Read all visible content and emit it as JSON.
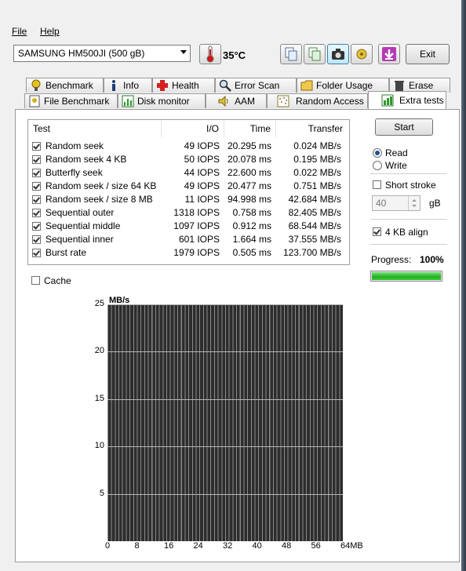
{
  "menu": {
    "file": "File",
    "help": "Help"
  },
  "toolbar": {
    "drive": "SAMSUNG HM500JI (500 gB)",
    "temperature": "35°C",
    "exit_label": "Exit"
  },
  "tabs_row1": [
    {
      "label": "Benchmark",
      "icon": "benchmark-icon"
    },
    {
      "label": "Info",
      "icon": "info-icon"
    },
    {
      "label": "Health",
      "icon": "health-cross-icon"
    },
    {
      "label": "Error Scan",
      "icon": "magnifier-icon"
    },
    {
      "label": "Folder Usage",
      "icon": "folder-icon"
    },
    {
      "label": "Erase",
      "icon": "trash-icon"
    }
  ],
  "tabs_row2": [
    {
      "label": "File Benchmark",
      "icon": "file-benchmark-icon"
    },
    {
      "label": "Disk monitor",
      "icon": "disk-monitor-icon"
    },
    {
      "label": "AAM",
      "icon": "speaker-icon"
    },
    {
      "label": "Random Access",
      "icon": "random-access-icon"
    },
    {
      "label": "Extra tests",
      "icon": "extra-tests-icon"
    }
  ],
  "table": {
    "headers": {
      "test": "Test",
      "io": "I/O",
      "time": "Time",
      "transfer": "Transfer"
    },
    "rows": [
      {
        "test": "Random seek",
        "io": "49 IOPS",
        "time": "20.295 ms",
        "transfer": "0.024 MB/s",
        "checked": true
      },
      {
        "test": "Random seek 4 KB",
        "io": "50 IOPS",
        "time": "20.078 ms",
        "transfer": "0.195 MB/s",
        "checked": true
      },
      {
        "test": "Butterfly seek",
        "io": "44 IOPS",
        "time": "22.600 ms",
        "transfer": "0.022 MB/s",
        "checked": true
      },
      {
        "test": "Random seek / size 64 KB",
        "io": "49 IOPS",
        "time": "20.477 ms",
        "transfer": "0.751 MB/s",
        "checked": true
      },
      {
        "test": "Random seek / size 8 MB",
        "io": "11 IOPS",
        "time": "94.998 ms",
        "transfer": "42.684 MB/s",
        "checked": true
      },
      {
        "test": "Sequential outer",
        "io": "1318 IOPS",
        "time": "0.758 ms",
        "transfer": "82.405 MB/s",
        "checked": true
      },
      {
        "test": "Sequential middle",
        "io": "1097 IOPS",
        "time": "0.912 ms",
        "transfer": "68.544 MB/s",
        "checked": true
      },
      {
        "test": "Sequential inner",
        "io": "601 IOPS",
        "time": "1.664 ms",
        "transfer": "37.555 MB/s",
        "checked": true
      },
      {
        "test": "Burst rate",
        "io": "1979 IOPS",
        "time": "0.505 ms",
        "transfer": "123.700 MB/s",
        "checked": true
      }
    ]
  },
  "options": {
    "start_label": "Start",
    "read_label": "Read",
    "write_label": "Write",
    "mode_selected": "Read",
    "short_stroke_label": "Short stroke",
    "short_stroke_checked": false,
    "short_stroke_value": "40",
    "short_stroke_unit": "gB",
    "align_label": "4 KB align",
    "align_checked": true,
    "progress_label": "Progress:",
    "progress_text": "100%",
    "progress_value": 1.0,
    "cache_label": "Cache",
    "cache_checked": false
  },
  "chart_data": {
    "type": "bar",
    "unit_label": "MB/s",
    "x_tick_labels": [
      "0",
      "8",
      "16",
      "24",
      "32",
      "40",
      "48",
      "56",
      "64MB"
    ],
    "y_tick_labels": [
      "5",
      "10",
      "15",
      "20",
      "25"
    ],
    "xlim": [
      0,
      64
    ],
    "ylim": [
      0,
      25
    ],
    "grid": true,
    "series": []
  },
  "colors": {
    "accent": "#1d4f91",
    "progress": "#22b122",
    "chart_bg": "#2d2d2d"
  }
}
